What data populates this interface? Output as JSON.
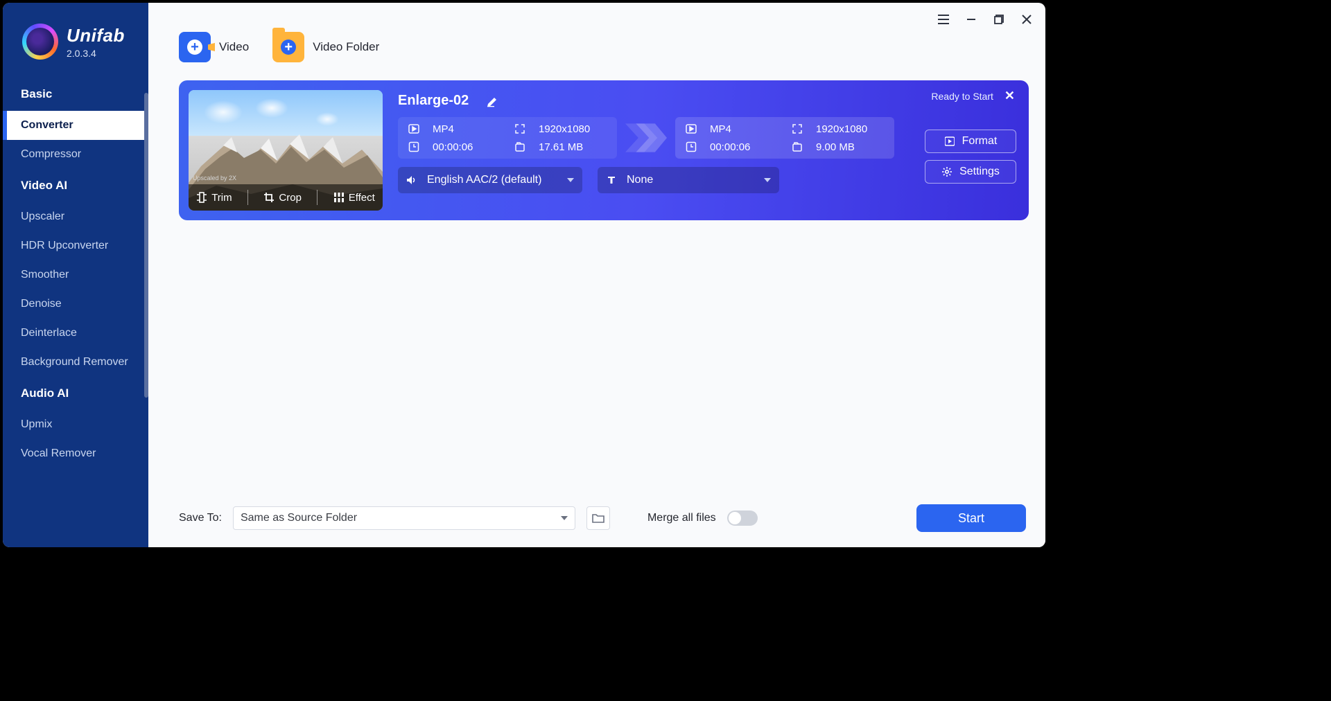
{
  "app": {
    "name": "Unifab",
    "version": "2.0.3.4"
  },
  "sidebar": {
    "sections": [
      {
        "head": "Basic",
        "items": [
          "Converter",
          "Compressor"
        ]
      },
      {
        "head": "Video AI",
        "items": [
          "Upscaler",
          "HDR Upconverter",
          "Smoother",
          "Denoise",
          "Deinterlace",
          "Background Remover"
        ]
      },
      {
        "head": "Audio AI",
        "items": [
          "Upmix",
          "Vocal Remover"
        ]
      }
    ],
    "active": "Converter"
  },
  "toolbar": {
    "add_video_label": "Video",
    "add_folder_label": "Video Folder"
  },
  "card": {
    "status": "Ready to Start",
    "filename": "Enlarge-02",
    "thumb_tag": "Upscaled by 2X",
    "tools": {
      "trim": "Trim",
      "crop": "Crop",
      "effect": "Effect"
    },
    "input": {
      "format": "MP4",
      "resolution": "1920x1080",
      "duration": "00:00:06",
      "size": "17.61 MB"
    },
    "output": {
      "format": "MP4",
      "resolution": "1920x1080",
      "duration": "00:00:06",
      "size": "9.00 MB"
    },
    "audio_select": "English AAC/2 (default)",
    "subtitle_select": "None",
    "format_btn": "Format",
    "settings_btn": "Settings"
  },
  "footer": {
    "save_to_label": "Save To:",
    "save_to_value": "Same as Source Folder",
    "merge_label": "Merge all files",
    "start_label": "Start"
  }
}
